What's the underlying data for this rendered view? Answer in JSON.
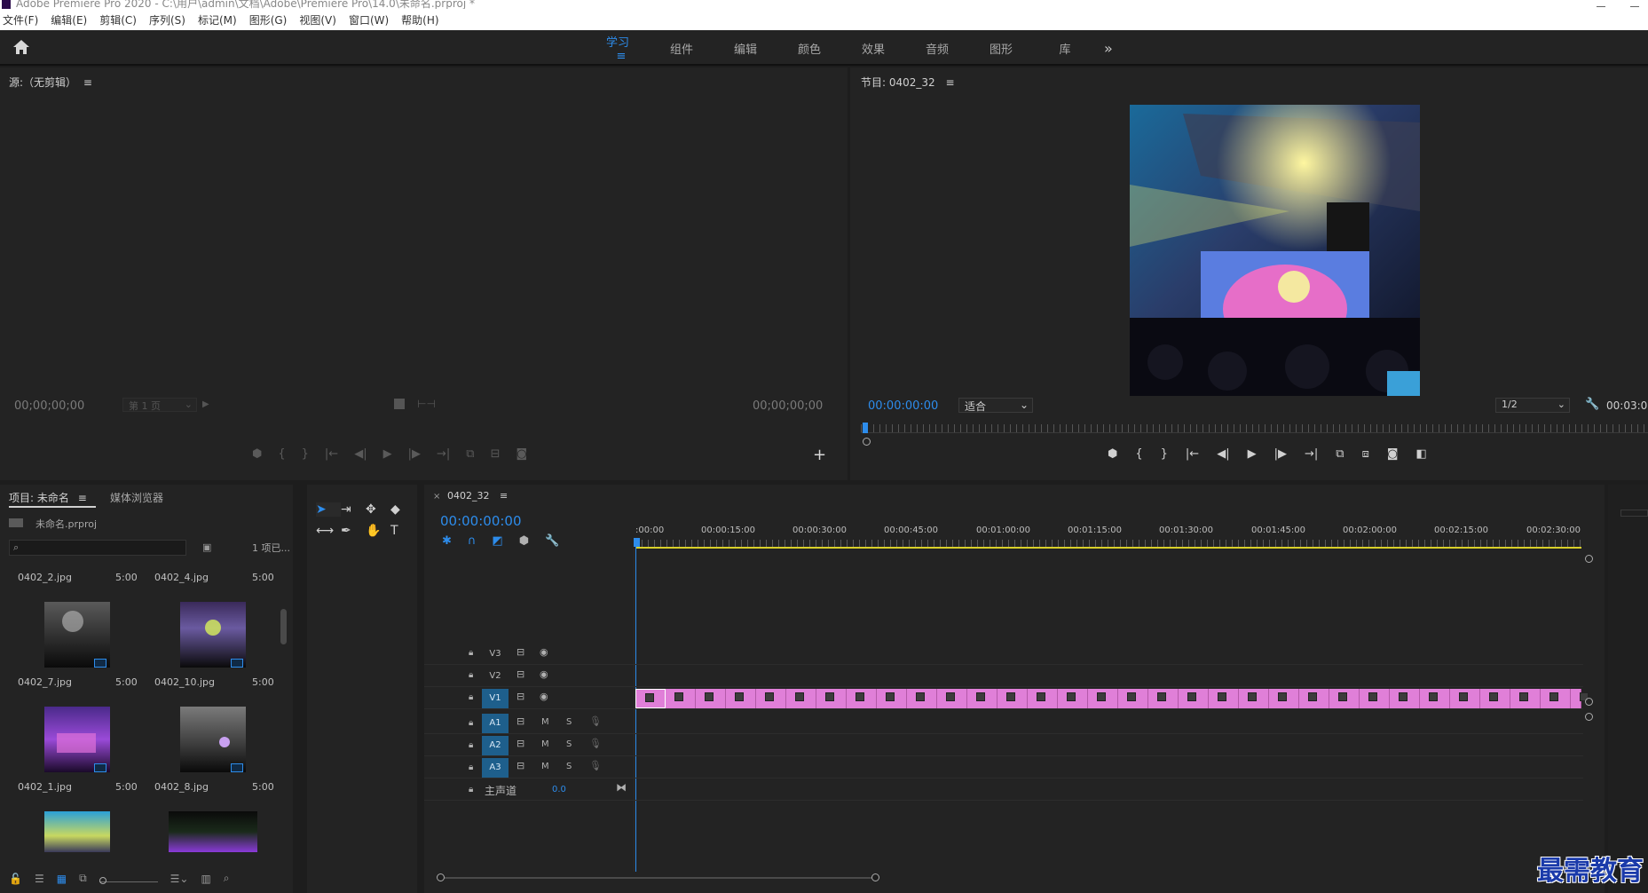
{
  "window": {
    "title": "Adobe Premiere Pro 2020 - C:\\用户\\admin\\文档\\Adobe\\Premiere Pro\\14.0\\未命名.prproj *"
  },
  "menu": [
    "文件(F)",
    "编辑(E)",
    "剪辑(C)",
    "序列(S)",
    "标记(M)",
    "图形(G)",
    "视图(V)",
    "窗口(W)",
    "帮助(H)"
  ],
  "workspaces": {
    "tabs": [
      "学习",
      "组件",
      "编辑",
      "颜色",
      "效果",
      "音频",
      "图形",
      "库"
    ],
    "active": "学习",
    "more": "»"
  },
  "source": {
    "title": "源:（无剪辑）",
    "timecode_left": "00;00;00;00",
    "page_select": "第 1 页",
    "timecode_right": "00;00;00;00"
  },
  "program": {
    "title": "节目: 0402_32",
    "timecode": "00:00:00:00",
    "fit": "适合",
    "quality": "1/2",
    "duration": "00:03:0"
  },
  "project": {
    "tab_project": "项目: 未命名",
    "tab_media": "媒体浏览器",
    "file": "未命名.prproj",
    "count": "1 项已...",
    "items": [
      {
        "name": "0402_2.jpg",
        "dur": "5:00"
      },
      {
        "name": "0402_4.jpg",
        "dur": "5:00"
      },
      {
        "name": "0402_7.jpg",
        "dur": "5:00"
      },
      {
        "name": "0402_10.jpg",
        "dur": "5:00"
      },
      {
        "name": "0402_1.jpg",
        "dur": "5:00"
      },
      {
        "name": "0402_8.jpg",
        "dur": "5:00"
      }
    ]
  },
  "timeline": {
    "tab": "0402_32",
    "timecode": "00:00:00:00",
    "ruler": [
      ":00:00",
      "00:00:15:00",
      "00:00:30:00",
      "00:00:45:00",
      "00:01:00:00",
      "00:01:15:00",
      "00:01:30:00",
      "00:01:45:00",
      "00:02:00:00",
      "00:02:15:00",
      "00:02:30:00"
    ],
    "tracks": {
      "v3": "V3",
      "v2": "V2",
      "v1": "V1",
      "a1": "A1",
      "a2": "A2",
      "a3": "A3",
      "m": "M",
      "s": "S",
      "master": "主声道",
      "master_val": "0.0"
    }
  },
  "watermark": "最需教育",
  "colors": {
    "accent": "#2d8ceb",
    "clip": "#e07fd8",
    "track_blue": "#1e5f8c"
  }
}
